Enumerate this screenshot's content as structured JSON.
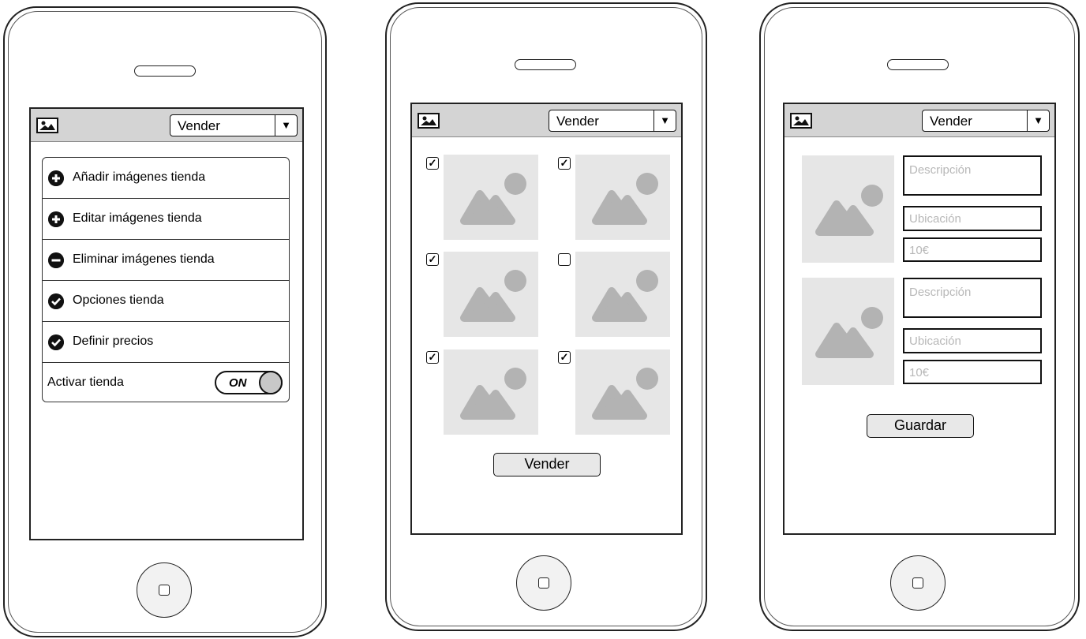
{
  "header": {
    "dropdown_value": "Vender",
    "dropdown_arrow": "▼"
  },
  "screen1": {
    "menu_items": [
      {
        "label": "Añadir imágenes tienda",
        "icon": "plus-circle-icon"
      },
      {
        "label": "Editar imágenes tienda",
        "icon": "plus-circle-icon"
      },
      {
        "label": "Eliminar imágenes tienda",
        "icon": "minus-circle-icon"
      },
      {
        "label": "Opciones tienda",
        "icon": "check-circle-icon"
      },
      {
        "label": "Definir precios",
        "icon": "check-circle-icon"
      }
    ],
    "activate_label": "Activar tienda",
    "toggle_text": "ON"
  },
  "screen2": {
    "checks": [
      "✓",
      "✓",
      "✓",
      "",
      "✓",
      "✓"
    ],
    "button_label": "Vender"
  },
  "screen3": {
    "items": [
      {
        "description_placeholder": "Descripción",
        "location_placeholder": "Ubicación",
        "price": "10€"
      },
      {
        "description_placeholder": "Descripción",
        "location_placeholder": "Ubicación",
        "price": "10€"
      }
    ],
    "button_label": "Guardar"
  },
  "colors": {
    "toolbar": "#d4d4d4",
    "placeholder_bg": "#e6e6e6",
    "placeholder_shape": "#b3b3b3"
  }
}
